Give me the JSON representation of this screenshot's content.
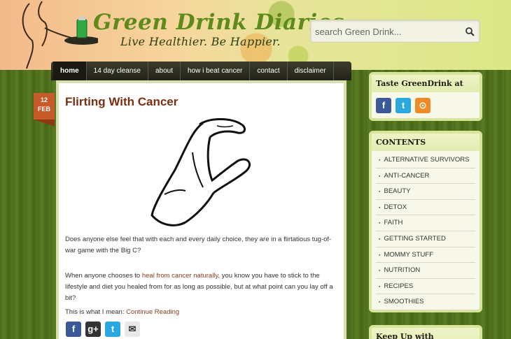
{
  "header": {
    "site_title": "Green Drink Diaries",
    "tagline": "Live Healthier. Be Happier.",
    "search_placeholder": "search Green Drink..."
  },
  "nav": {
    "items": [
      "home",
      "14 day cleanse",
      "about",
      "how i beat cancer",
      "contact",
      "disclaimer"
    ]
  },
  "post": {
    "date_day": "12",
    "date_month": "FEB",
    "title": "Flirting With Cancer",
    "para1": "Does anyone else feel that with each and every daily choice, they are in a flirtatious tug-of-war game with the Big C?",
    "para2_before": "When anyone chooses to",
    "para2_link": "heal from cancer naturally",
    "para2_after": ", you know you have to stick to the lifestyle and diet you healed from for as long as possible, but at what point can you lay off a bit?",
    "para3_text": "This is what I mean:",
    "para3_link": "Continue Reading"
  },
  "sidebar": {
    "taste_title": "Taste GreenDrink at",
    "contents_title": "CONTENTS",
    "categories": [
      "ALTERNATIVE SURVIVORS",
      "ANTI-CANCER",
      "BEAUTY",
      "DETOX",
      "FAITH",
      "GETTING STARTED",
      "MOMMY STUFF",
      "NUTRITION",
      "RECIPES",
      "SMOOTHIES"
    ],
    "keepup_title": "Keep Up with GreenDrink!"
  },
  "colors": {
    "accent_green": "#5d8a1b",
    "title_brown": "#7a2e12",
    "badge_orange": "#c65a28",
    "facebook": "#3b5998",
    "twitter": "#2aa9e0",
    "rss": "#f08a24",
    "google": "#333333"
  }
}
